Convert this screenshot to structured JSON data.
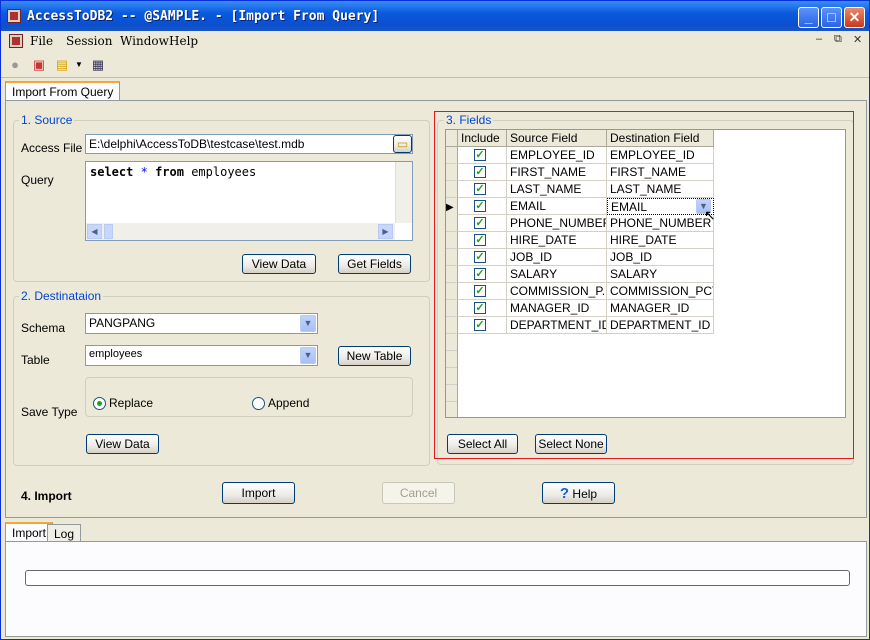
{
  "window": {
    "title": "AccessToDB2 -- @SAMPLE. - [Import From Query]"
  },
  "menu": {
    "items": [
      "File",
      "Session",
      "Window",
      "Help"
    ]
  },
  "tabs": {
    "main": "Import From Query",
    "bottom": [
      "Import",
      "Log"
    ]
  },
  "source": {
    "legend": "1. Source",
    "access_file_label": "Access File",
    "access_file_value": "E:\\delphi\\AccessToDB\\testcase\\test.mdb",
    "query_label": "Query",
    "query_value": [
      "select",
      "*",
      "from",
      "employees"
    ],
    "view_data": "View Data",
    "get_fields": "Get Fields"
  },
  "destination": {
    "legend": "2. Destinataion",
    "schema_label": "Schema",
    "schema_value": "PANGPANG",
    "table_label": "Table",
    "table_value": "employees",
    "new_table": "New Table",
    "save_type_label": "Save Type",
    "replace": "Replace",
    "append": "Append",
    "save_type_selected": "Replace",
    "view_data": "View Data"
  },
  "fields": {
    "legend": "3. Fields",
    "columns": [
      "Include",
      "Source Field",
      "Destination Field"
    ],
    "rows": [
      {
        "include": true,
        "source": "EMPLOYEE_ID",
        "dest": "EMPLOYEE_ID"
      },
      {
        "include": true,
        "source": "FIRST_NAME",
        "dest": "FIRST_NAME"
      },
      {
        "include": true,
        "source": "LAST_NAME",
        "dest": "LAST_NAME"
      },
      {
        "include": true,
        "source": "EMAIL",
        "dest": "EMAIL"
      },
      {
        "include": true,
        "source": "PHONE_NUMBER",
        "dest": "PHONE_NUMBER"
      },
      {
        "include": true,
        "source": "HIRE_DATE",
        "dest": "HIRE_DATE"
      },
      {
        "include": true,
        "source": "JOB_ID",
        "dest": "JOB_ID"
      },
      {
        "include": true,
        "source": "SALARY",
        "dest": "SALARY"
      },
      {
        "include": true,
        "source": "COMMISSION_P...",
        "dest": "COMMISSION_PCT"
      },
      {
        "include": true,
        "source": "MANAGER_ID",
        "dest": "MANAGER_ID"
      },
      {
        "include": true,
        "source": "DEPARTMENT_ID",
        "dest": "DEPARTMENT_ID"
      }
    ],
    "select_all": "Select All",
    "select_none": "Select None"
  },
  "actions": {
    "section_label": "4. Import",
    "import": "Import",
    "cancel": "Cancel",
    "help": "Help"
  },
  "progress": {
    "value": 0
  },
  "colors": {
    "title_blue": "#0a5bde",
    "highlight_red": "#e0191f",
    "check_green": "#21a121",
    "legend_blue": "#0046d5"
  }
}
